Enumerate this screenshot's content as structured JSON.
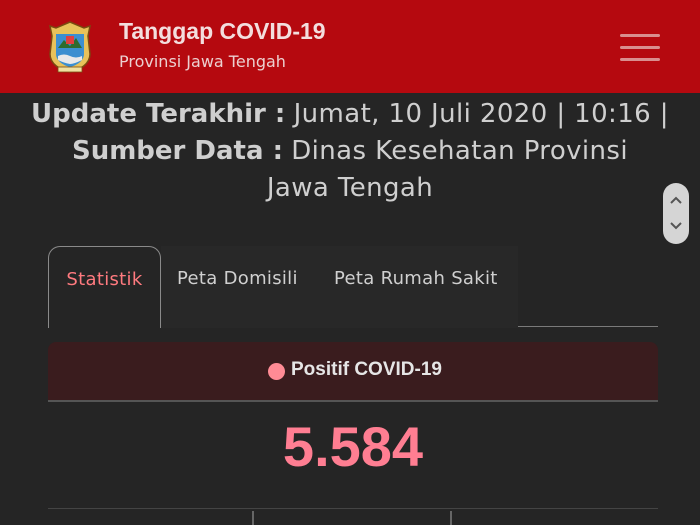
{
  "header": {
    "title": "Tanggap COVID-19",
    "subtitle": "Provinsi Jawa Tengah",
    "logo_icon": "jawa-tengah-crest-icon",
    "menu_icon": "hamburger-menu-icon",
    "background": "#b5090f"
  },
  "update": {
    "updated_label": "Update Terakhir :",
    "updated_value": "Jumat, 10 Juli 2020 | 10:16 |",
    "source_label": "Sumber Data :",
    "source_value": "Dinas Kesehatan Provinsi Jawa Tengah"
  },
  "tabs": [
    {
      "label": "Statistik",
      "active": true
    },
    {
      "label": "Peta Domisili",
      "active": false
    },
    {
      "label": "Peta Rumah Sakit",
      "active": false
    }
  ],
  "stat": {
    "label": "Positif COVID-19",
    "value": "5.584",
    "accent": "#ff7e92"
  }
}
